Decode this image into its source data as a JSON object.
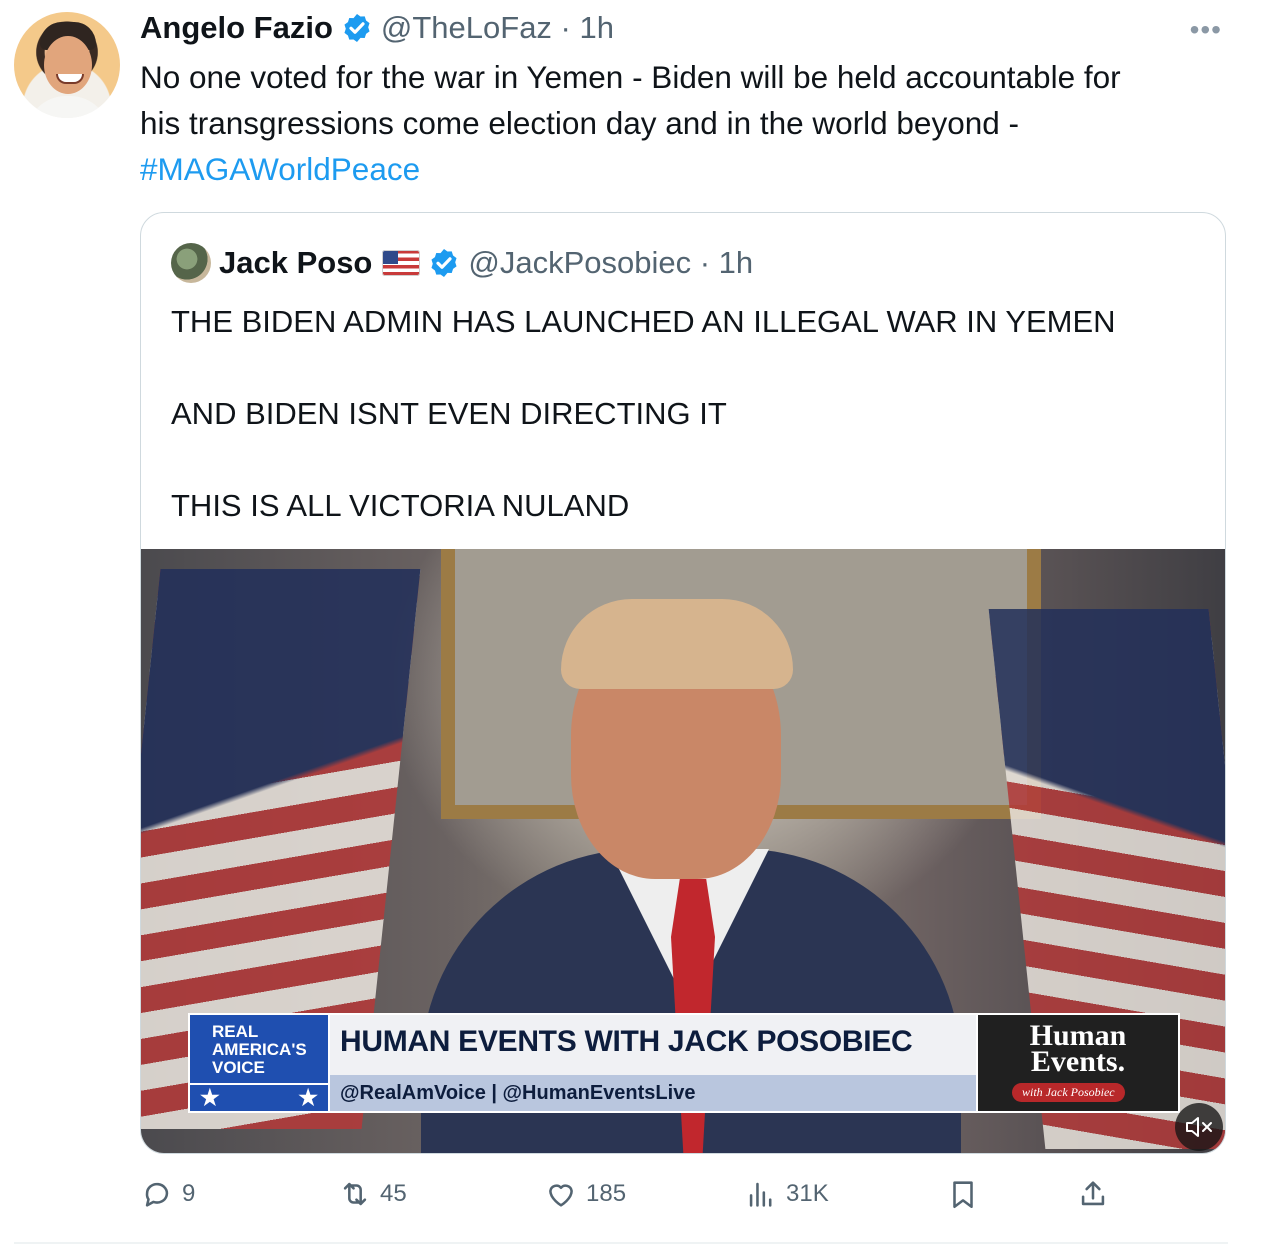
{
  "tweet": {
    "author_name": "Angelo Fazio",
    "handle_time": "@TheLoFaz · 1h",
    "text_line1": "No one voted for the war in Yemen - Biden will be held accountable for",
    "text_line2": "his transgressions come election day and in the world beyond -",
    "hashtag": "#MAGAWorldPeace",
    "more_icon": "•••"
  },
  "quote": {
    "author_name": "Jack Poso",
    "handle_time": "@JackPosobiec · 1h",
    "line1": "THE BIDEN ADMIN HAS LAUNCHED AN ILLEGAL WAR IN YEMEN",
    "line2": "AND BIDEN ISNT EVEN DIRECTING IT",
    "line3": "THIS IS ALL VICTORIA NULAND",
    "video": {
      "network_l1": "REAL",
      "network_l2": "AMERICA'S",
      "network_l3": "VOICE",
      "stars_left": "★",
      "stars_right": "★",
      "show_title": "HUMAN EVENTS WITH JACK POSOBIEC",
      "show_handles": "@RealAmVoice | @HumanEventsLive",
      "logo_l1": "Human",
      "logo_l2": "Events.",
      "logo_tag": "with Jack Posobiec"
    }
  },
  "actions": {
    "replies": "9",
    "reposts": "45",
    "likes": "185",
    "views": "31K"
  },
  "colors": {
    "accent": "#1d9bf0",
    "secondary_text": "#536471",
    "border": "#cfd9de"
  }
}
